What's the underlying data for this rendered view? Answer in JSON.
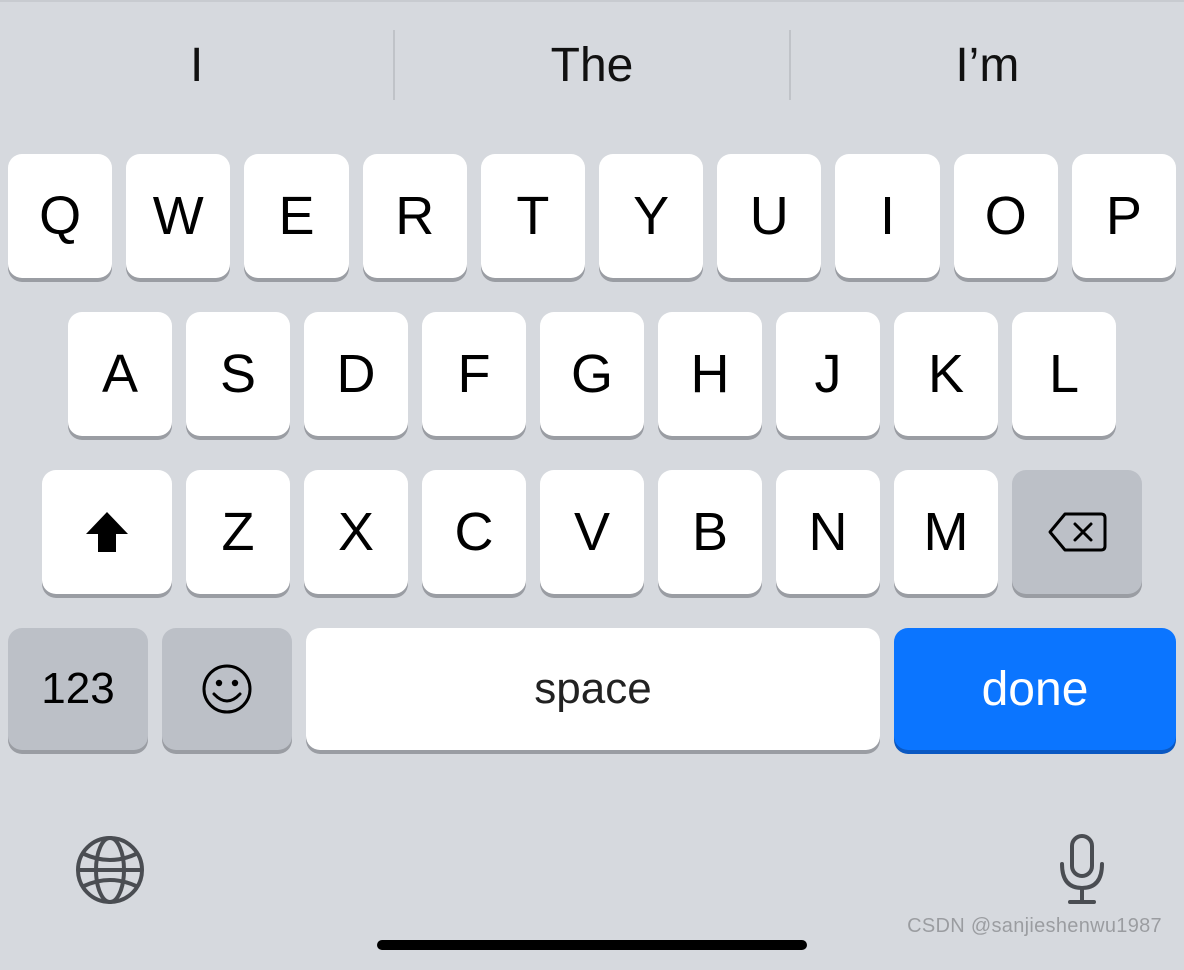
{
  "suggestions": [
    "I",
    "The",
    "I’m"
  ],
  "rows": {
    "row1": [
      "Q",
      "W",
      "E",
      "R",
      "T",
      "Y",
      "U",
      "I",
      "O",
      "P"
    ],
    "row2": [
      "A",
      "S",
      "D",
      "F",
      "G",
      "H",
      "J",
      "K",
      "L"
    ],
    "row3": [
      "Z",
      "X",
      "C",
      "V",
      "B",
      "N",
      "M"
    ]
  },
  "controls": {
    "numbers": "123",
    "space": "space",
    "done": "done"
  },
  "watermark": "CSDN @sanjieshenwu1987"
}
